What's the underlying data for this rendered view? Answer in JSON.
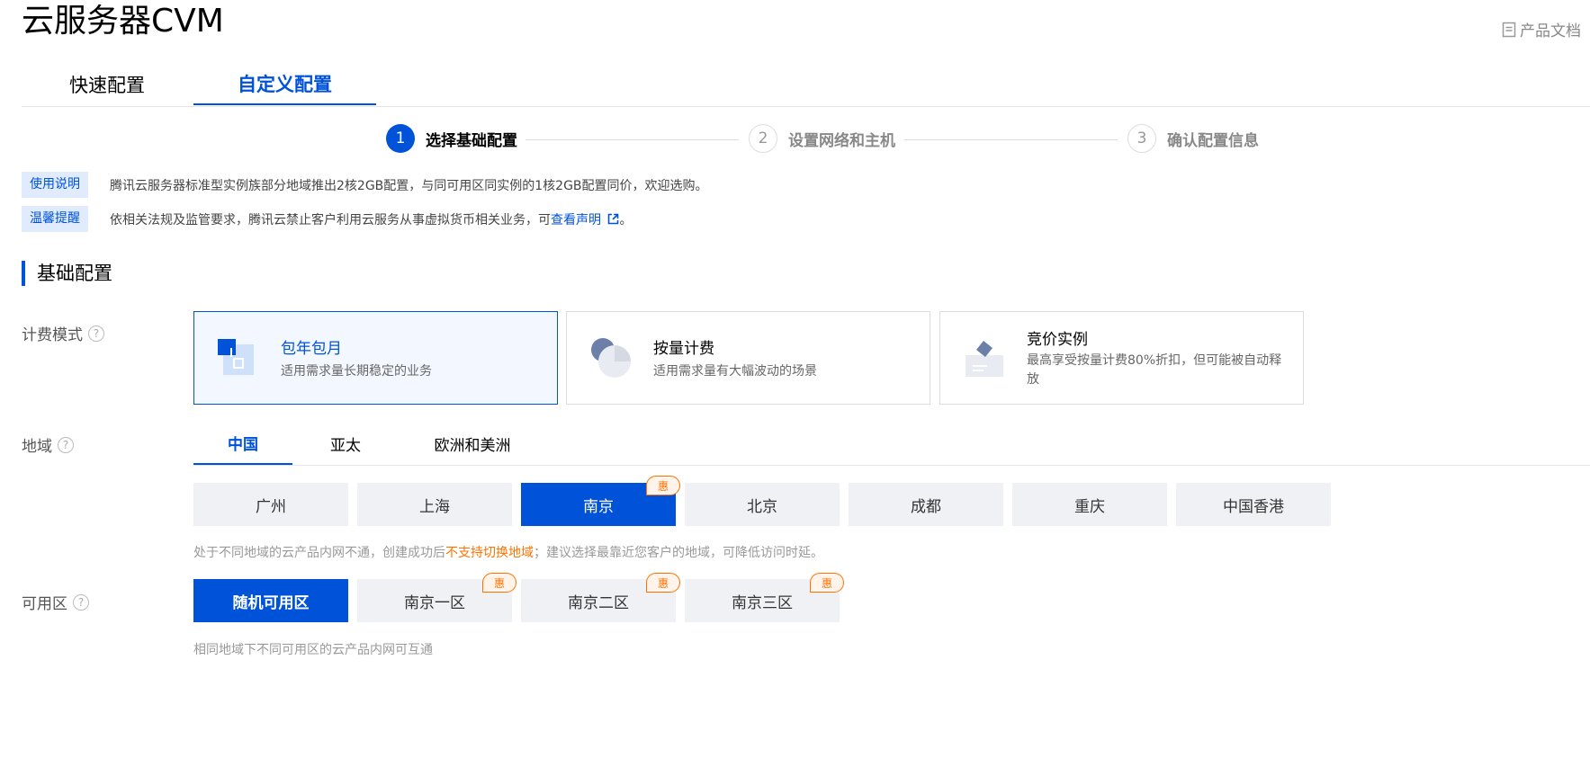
{
  "header": {
    "title": "云服务器CVM",
    "docs_label": "产品文档",
    "tabs": [
      {
        "label": "快速配置",
        "active": false
      },
      {
        "label": "自定义配置",
        "active": true
      }
    ]
  },
  "steps": [
    {
      "num": "1",
      "label": "选择基础配置",
      "active": true
    },
    {
      "num": "2",
      "label": "设置网络和主机",
      "active": false
    },
    {
      "num": "3",
      "label": "确认配置信息",
      "active": false
    }
  ],
  "notices": [
    {
      "tag": "使用说明",
      "text": "腾讯云服务器标准型实例族部分地域推出2核2GB配置，与同可用区同实例的1核2GB配置同价，欢迎选购。",
      "link": "",
      "suffix": ""
    },
    {
      "tag": "温馨提醒",
      "text": "依相关法规及监管要求，腾讯云禁止客户利用云服务从事虚拟货币相关业务，可",
      "link": "查看声明",
      "suffix": "。"
    }
  ],
  "section_title": "基础配置",
  "billing": {
    "label": "计费模式",
    "options": [
      {
        "title": "包年包月",
        "desc": "适用需求量长期稳定的业务",
        "selected": true,
        "icon": "calendar-icon"
      },
      {
        "title": "按量计费",
        "desc": "适用需求量有大幅波动的场景",
        "selected": false,
        "icon": "pie-chart-icon"
      },
      {
        "title": "竞价实例",
        "desc": "最高享受按量计费80%折扣，但可能被自动释放",
        "selected": false,
        "icon": "bid-gavel-icon"
      }
    ]
  },
  "region": {
    "label": "地域",
    "tabs": [
      {
        "label": "中国",
        "active": true
      },
      {
        "label": "亚太",
        "active": false
      },
      {
        "label": "欧洲和美洲",
        "active": false
      }
    ],
    "cities": [
      {
        "label": "广州",
        "selected": false,
        "badge": ""
      },
      {
        "label": "上海",
        "selected": false,
        "badge": ""
      },
      {
        "label": "南京",
        "selected": true,
        "badge": "惠"
      },
      {
        "label": "北京",
        "selected": false,
        "badge": ""
      },
      {
        "label": "成都",
        "selected": false,
        "badge": ""
      },
      {
        "label": "重庆",
        "selected": false,
        "badge": ""
      },
      {
        "label": "中国香港",
        "selected": false,
        "badge": ""
      }
    ],
    "hint_before": "处于不同地域的云产品内网不通，创建成功后",
    "hint_warn": "不支持切换地域",
    "hint_after": "；建议选择最靠近您客户的地域，可降低访问时延。"
  },
  "zone": {
    "label": "可用区",
    "options": [
      {
        "label": "随机可用区",
        "selected": true,
        "badge": ""
      },
      {
        "label": "南京一区",
        "selected": false,
        "badge": "惠"
      },
      {
        "label": "南京二区",
        "selected": false,
        "badge": "惠"
      },
      {
        "label": "南京三区",
        "selected": false,
        "badge": "惠"
      }
    ],
    "hint": "相同地域下不同可用区的云产品内网可互通"
  },
  "colors": {
    "accent": "#0052d9",
    "badge": "#ff7200",
    "option_bg": "#f0f1f4"
  }
}
